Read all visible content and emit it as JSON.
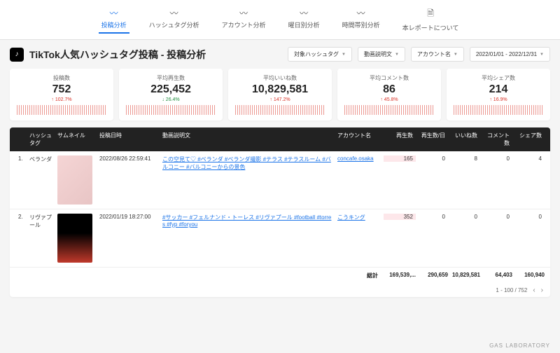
{
  "tabs": [
    {
      "label": "投稿分析",
      "active": true
    },
    {
      "label": "ハッシュタグ分析",
      "active": false
    },
    {
      "label": "アカウント分析",
      "active": false
    },
    {
      "label": "曜日別分析",
      "active": false
    },
    {
      "label": "時間帯別分析",
      "active": false
    },
    {
      "label": "本レポートについて",
      "active": false
    }
  ],
  "page_title": "TikTok人気ハッシュタグ投稿 - 投稿分析",
  "filters": {
    "hashtag": "対象ハッシュタグ",
    "desc": "動画説明文",
    "account": "アカウント名",
    "date_range": "2022/01/01 - 2022/12/31"
  },
  "kpis": [
    {
      "label": "投稿数",
      "value": "752",
      "delta": "102.7%",
      "dir": "up"
    },
    {
      "label": "平均再生数",
      "value": "225,452",
      "delta": "26.4%",
      "dir": "down"
    },
    {
      "label": "平均いいね数",
      "value": "10,829,581",
      "delta": "147.2%",
      "dir": "up"
    },
    {
      "label": "平均コメント数",
      "value": "86",
      "delta": "45.8%",
      "dir": "up"
    },
    {
      "label": "平均シェア数",
      "value": "214",
      "delta": "16.9%",
      "dir": "up"
    }
  ],
  "columns": {
    "idx": "",
    "hashtag": "ハッシュタグ",
    "thumb": "サムネイル",
    "date": "投稿日時",
    "desc": "動画説明文",
    "account": "アカウント名",
    "plays": "再生数",
    "plays_day": "再生数/日",
    "likes": "いいね数",
    "comments": "コメント数",
    "shares": "シェア数"
  },
  "rows": [
    {
      "idx": "1.",
      "hashtag": "ベランダ",
      "date": "2022/08/26 22:59:41",
      "desc": "この空見て♡ #ベランダ #ベランダ撮影 #テラス #テラスルーム #バルコニー #バルコニーからの景色",
      "account": "concafe.osaka",
      "plays": "165",
      "plays_day": "0",
      "likes": "8",
      "comments": "0",
      "shares": "4"
    },
    {
      "idx": "2.",
      "hashtag": "リヴァプール",
      "date": "2022/01/19 18:27:00",
      "desc": "#サッカー #フェルナンド・トーレス #リヴァプール #football #torres #fyp #foryou",
      "account": "こうキング",
      "plays": "352",
      "plays_day": "0",
      "likes": "0",
      "comments": "0",
      "shares": "0"
    }
  ],
  "totals": {
    "label": "総計",
    "plays": "169,539,...",
    "plays_day": "290,659",
    "likes": "10,829,581",
    "comments": "64,403",
    "shares": "160,940"
  },
  "pager": {
    "range": "1 - 100 / 752"
  },
  "footer_brand": "GAS LABORATORY"
}
